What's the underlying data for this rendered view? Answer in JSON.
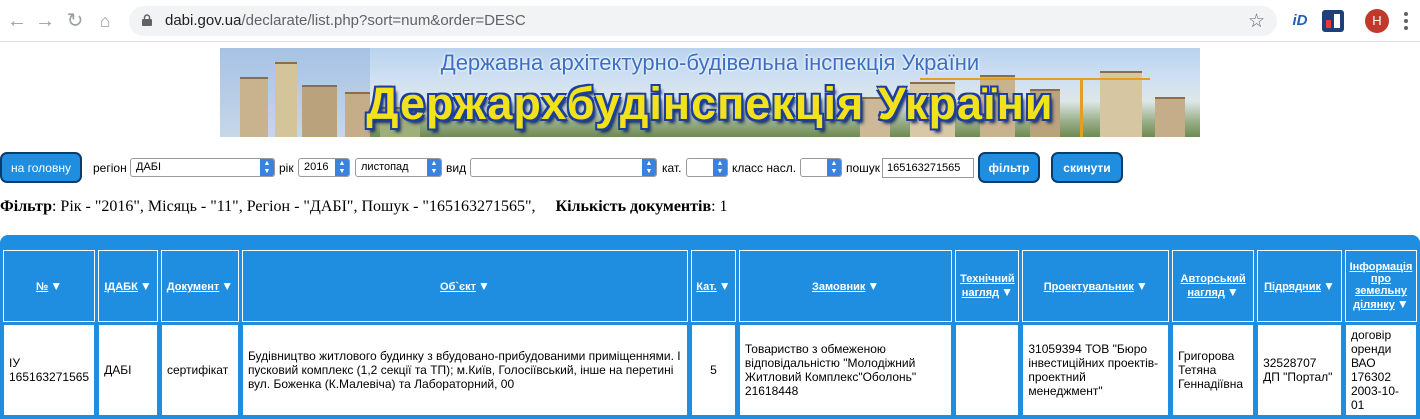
{
  "browser": {
    "url_host": "dabi.gov.ua",
    "url_path": "/declarate/list.php?sort=num&order=DESC",
    "profile_initial": "H",
    "ext_label": "iD"
  },
  "banner": {
    "subtitle": "Державна архітектурно-будівельна інспекція України",
    "title": "Держархбудінспекція України"
  },
  "filters": {
    "home_button": "на головну",
    "region_label": "регіон",
    "region_value": "ДАБІ",
    "year_label": "рік",
    "year_value": "2016",
    "month_value": "листопад",
    "type_label": "вид",
    "type_value": "",
    "cat_label": "кат.",
    "cat_value": "",
    "class_label": "класс насл.",
    "class_value": "",
    "search_label": "пошук",
    "search_value": "165163271565",
    "filter_button": "фільтр",
    "reset_button": "скинути"
  },
  "summary": {
    "filter_label": "Фільтр",
    "filter_text": ": Рік - \"2016\", Місяць - \"11\", Регіон - \"ДАБІ\", Пошук - \"165163271565\",",
    "count_label": "Кількість документів",
    "count_value": ": 1"
  },
  "table": {
    "headers": [
      {
        "label": "№",
        "sort": "▼"
      },
      {
        "label": "ІДАБК",
        "sort": "▼"
      },
      {
        "label": "Документ",
        "sort": "▼"
      },
      {
        "label": "Об`єкт",
        "sort": "▼"
      },
      {
        "label": "Кат.",
        "sort": "▼"
      },
      {
        "label": "Замовник",
        "sort": "▼"
      },
      {
        "label": "Технічний нагляд",
        "sort": "▼"
      },
      {
        "label": "Проектувальник",
        "sort": "▼"
      },
      {
        "label": "Авторський нагляд",
        "sort": "▼"
      },
      {
        "label": "Підрядник",
        "sort": "▼"
      },
      {
        "label": "Інформація про земельну ділянку",
        "sort": "▼"
      }
    ],
    "rows": [
      [
        "ІУ 165163271565",
        "ДАБІ",
        "сертифікат",
        "Будівництво житлового будинку з вбудовано-прибудованими приміщеннями. І пусковий комплекс (1,2 секції та ТП); м.Київ, Голосіївський, інше на перетині вул. Боженка (К.Малевіча) та Лабораторний, 00",
        "5",
        "Товариство з обмеженою відповідальністю \"Молодіжний Житловий Комплекс\"Оболонь\" 21618448",
        "",
        "31059394 ТОВ \"Бюро інвестиційних проектів-проектний менеджмент\"",
        "Григорова Тетяна Геннадіївна",
        "32528707 ДП \"Портал\"",
        "договір оренди ВАО 176302 2003-10-01"
      ]
    ]
  }
}
